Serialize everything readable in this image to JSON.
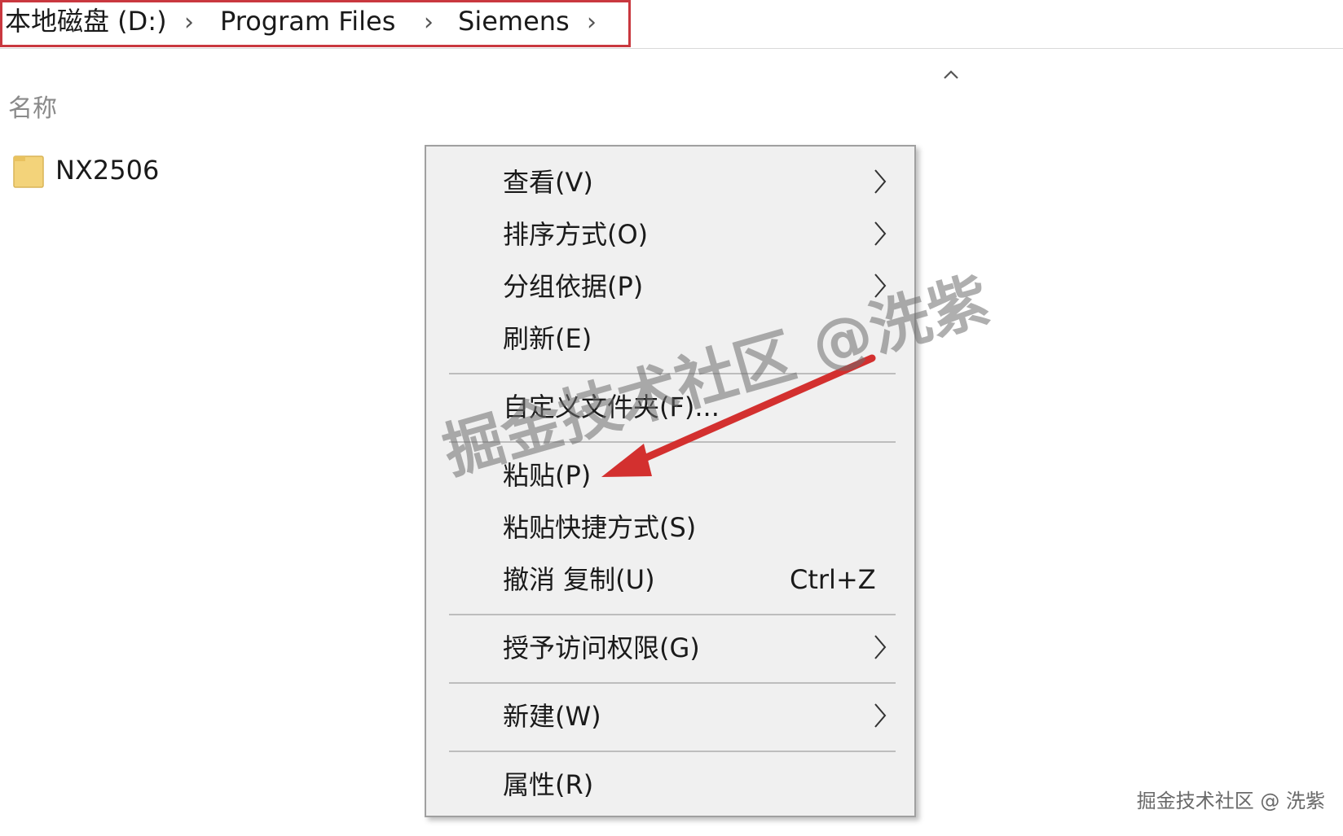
{
  "breadcrumb": {
    "items": [
      "本地磁盘 (D:)",
      "Program Files",
      "Siemens"
    ],
    "separator": "›"
  },
  "file_list": {
    "column_name": "名称",
    "items": [
      {
        "name": "NX2506",
        "icon": "folder-icon"
      }
    ]
  },
  "context_menu": {
    "view": "查看(V)",
    "sort_by": "排序方式(O)",
    "group_by": "分组依据(P)",
    "refresh": "刷新(E)",
    "customize": "自定义文件夹(F)...",
    "paste": "粘贴(P)",
    "paste_shortcut": "粘贴快捷方式(S)",
    "undo_copy": "撤消 复制(U)",
    "undo_shortcut": "Ctrl+Z",
    "give_access": "授予访问权限(G)",
    "new": "新建(W)",
    "properties": "属性(R)"
  },
  "watermark": {
    "overlay": "掘金技术社区 @洗紫",
    "corner": "掘金技术社区 @ 洗紫"
  },
  "colors": {
    "highlight_box": "#c9383f",
    "arrow": "#d3302f",
    "folder": "#f3d37a",
    "menu_bg": "#f0f0f0"
  }
}
